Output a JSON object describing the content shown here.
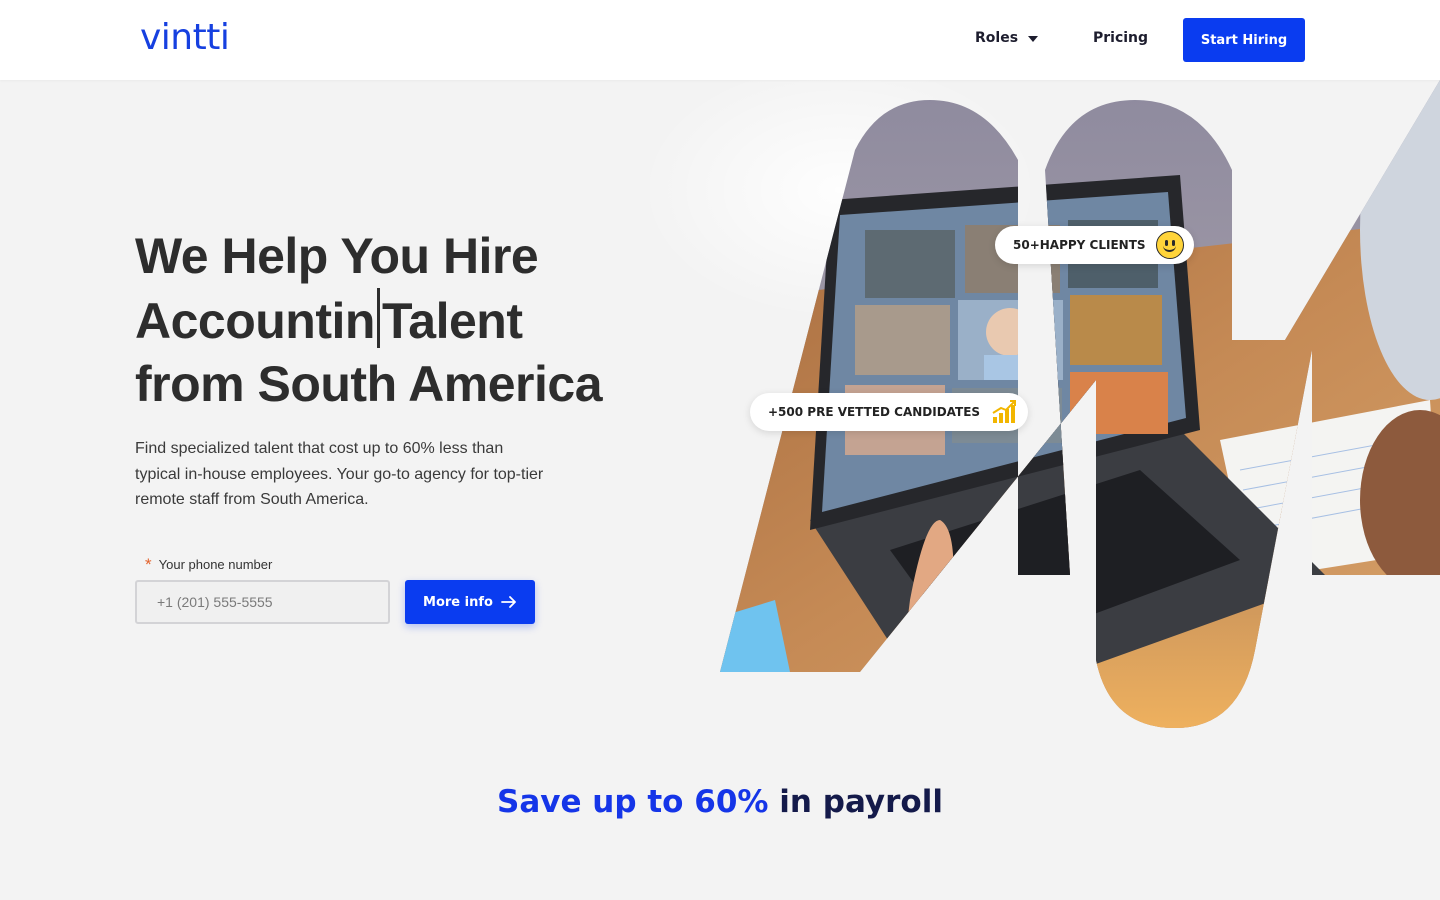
{
  "header": {
    "logo_text": "vintti",
    "nav": {
      "roles_label": "Roles",
      "pricing_label": "Pricing"
    },
    "cta_label": "Start Hiring"
  },
  "hero": {
    "title_line1": "We Help You Hire",
    "title_line2_prefix": "Accountin",
    "title_line2_suffix": "Talent",
    "title_line3": "from South America",
    "subtitle": "Find specialized talent that cost up to 60% less than typical in-house employees. Your go-to agency for top-tier remote staff from South America."
  },
  "form": {
    "phone_label": "Your phone number",
    "required_mark": "*",
    "phone_placeholder": "+1 (201) 555-5555",
    "submit_label": "More info"
  },
  "badges": {
    "clients": "50+HAPPY CLIENTS",
    "candidates": "+500 PRE VETTED CANDIDATES"
  },
  "savings": {
    "highlight": "Save up to 60%",
    "rest": "in payroll"
  },
  "icons": {
    "caret": "chevron-down-icon",
    "arrow": "arrow-right-icon",
    "smiley": "smiley-icon",
    "growth": "growth-chart-icon"
  },
  "colors": {
    "brand_blue": "#0a3cf0",
    "heading_dark": "#2d2d2d",
    "navy": "#141a4a",
    "required_orange": "#e2622b"
  }
}
